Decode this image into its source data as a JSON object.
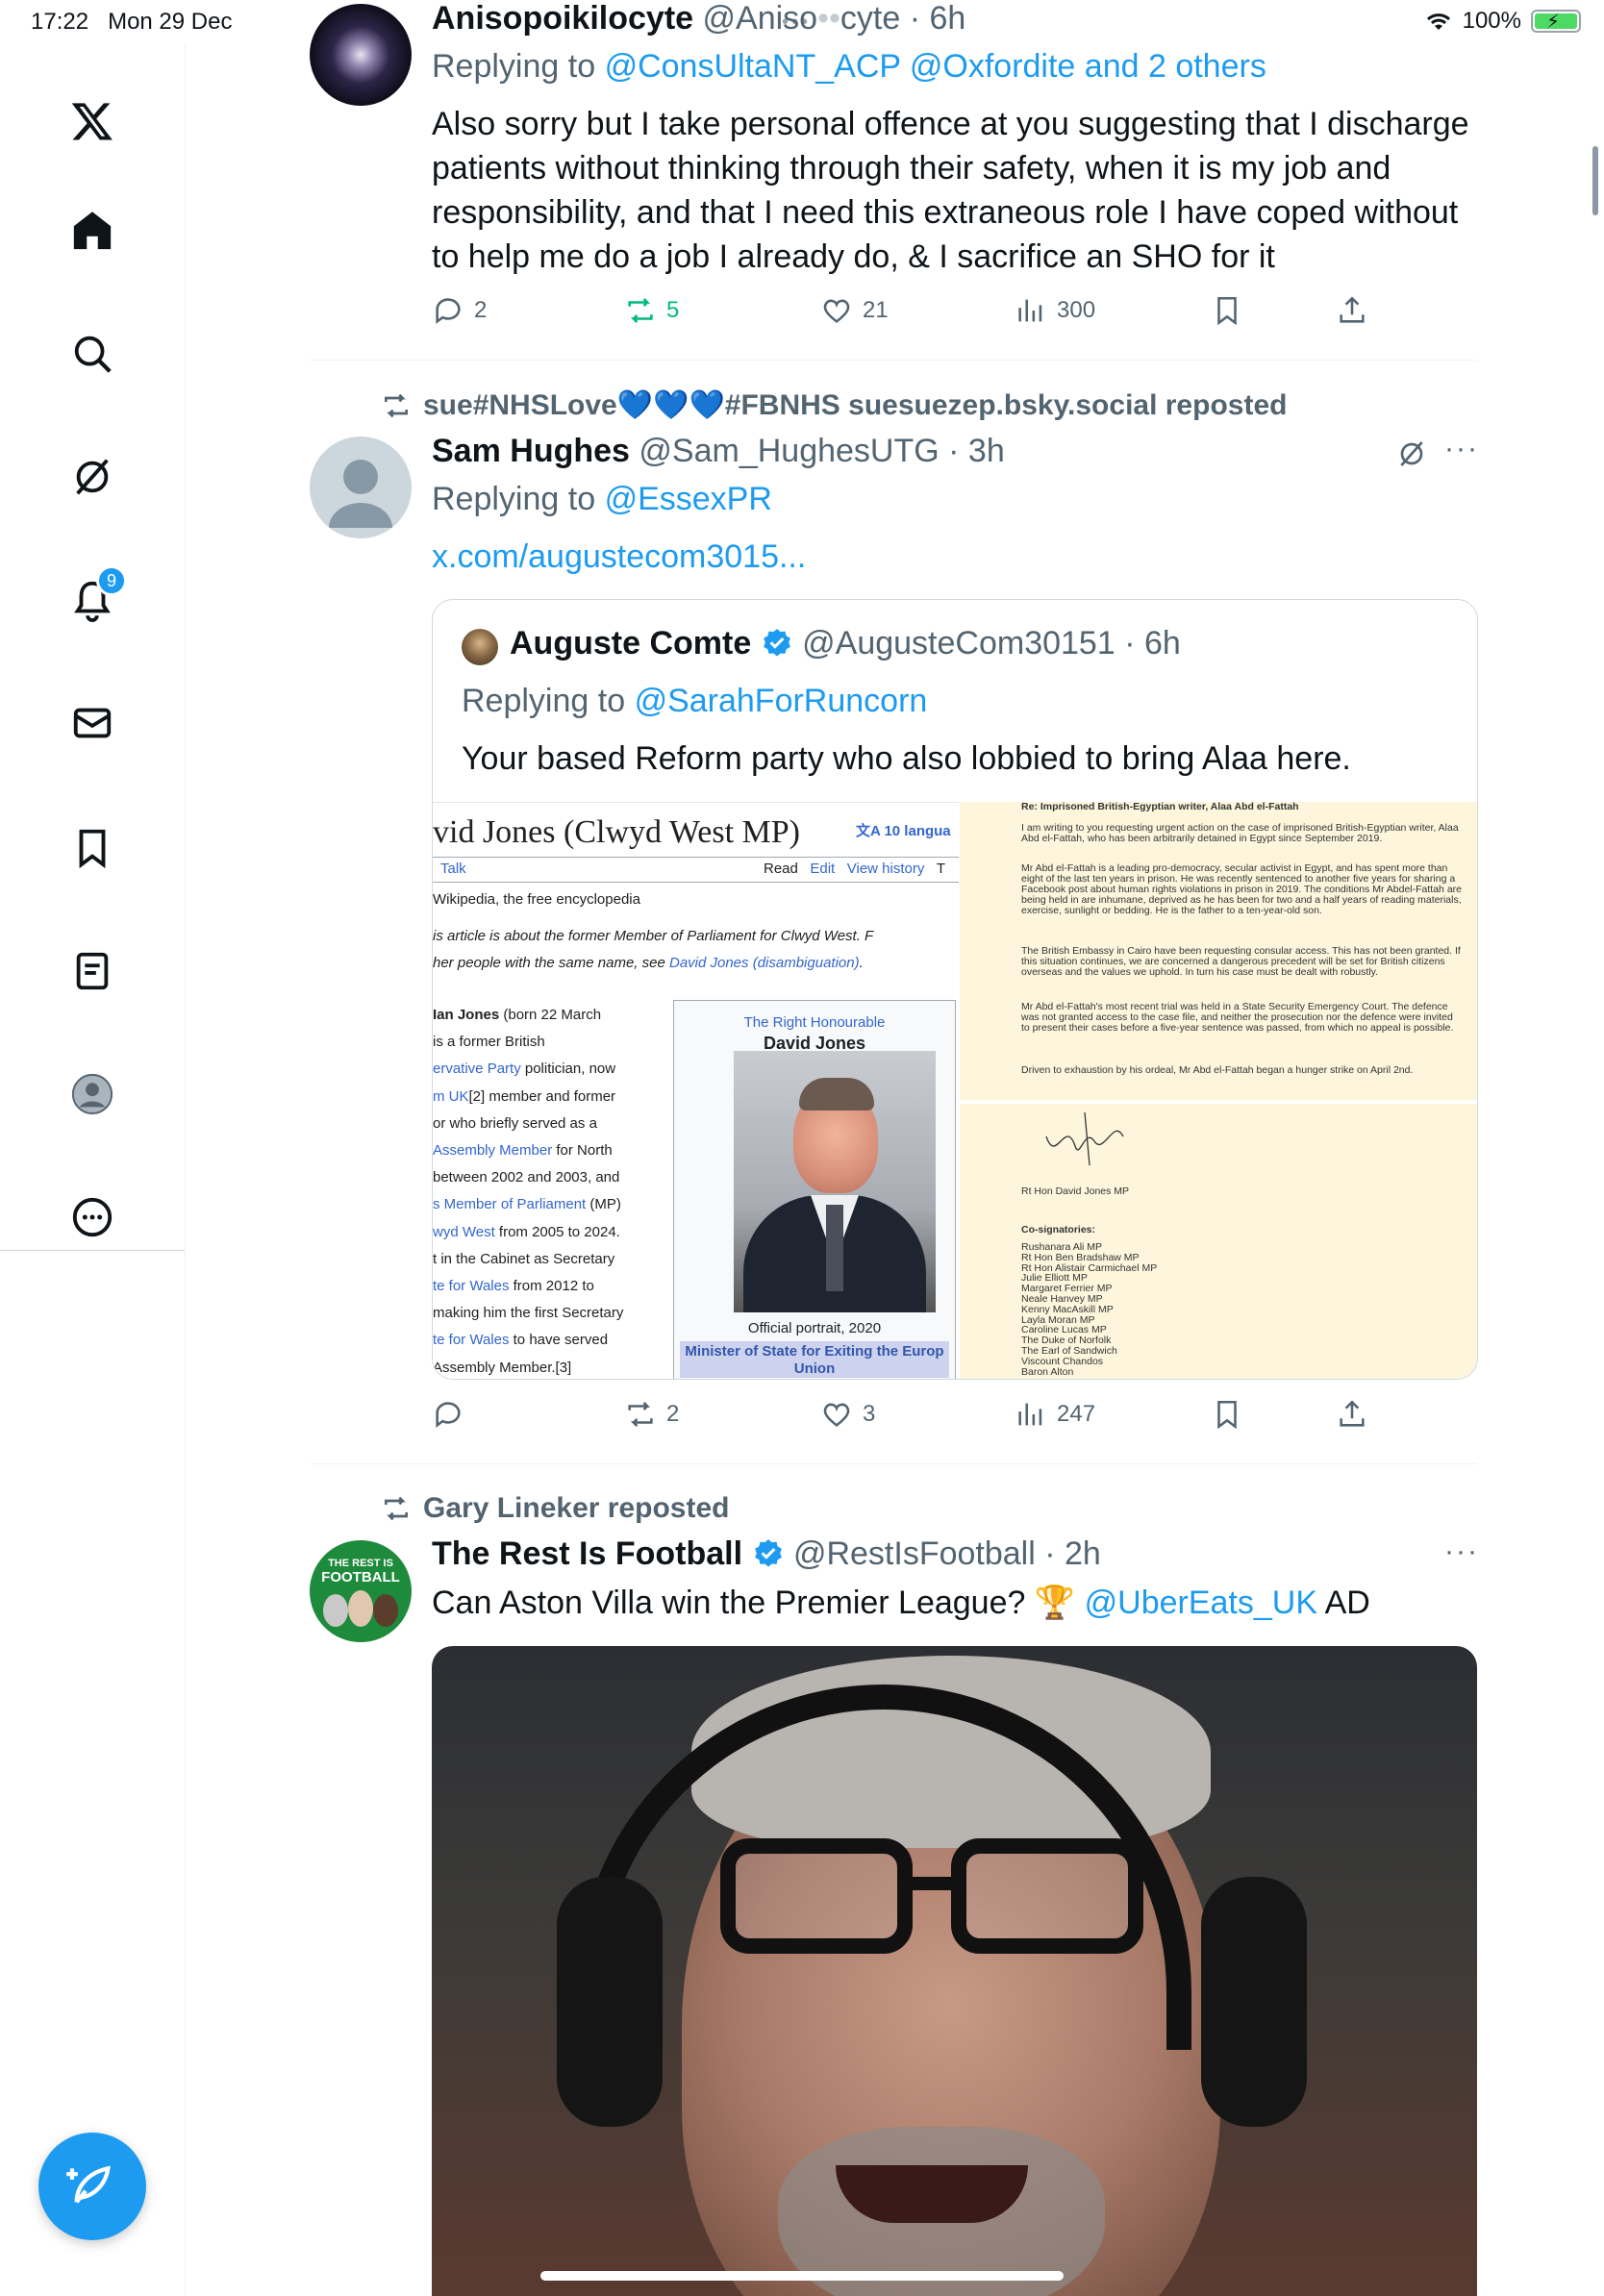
{
  "status_bar": {
    "time": "17:22",
    "date": "Mon 29 Dec",
    "battery": "100%"
  },
  "sidebar": {
    "items": [
      {
        "icon": "x-logo-icon"
      },
      {
        "icon": "home-icon"
      },
      {
        "icon": "search-icon"
      },
      {
        "icon": "grok-icon"
      },
      {
        "icon": "bell-icon",
        "badge": "9"
      },
      {
        "icon": "mail-icon"
      },
      {
        "icon": "bookmark-icon"
      },
      {
        "icon": "lists-icon"
      },
      {
        "icon": "profile-icon"
      },
      {
        "icon": "more-icon"
      }
    ],
    "compose_icon": "compose-icon"
  },
  "tweets": [
    {
      "name": "Anisopoikilocyte",
      "handle": "@Aniso",
      "handle_tail": "cyte",
      "time": "· 6h",
      "replying_prefix": "Replying to",
      "replying_to": "@ConsUltaNT_ACP @Oxfordite and 2 others",
      "text_lines": [
        "Also sorry but I take personal offence at you suggesting that I discharge",
        "patients without thinking through their safety, when it is my job and",
        "responsibility, and that I need this extraneous role I have coped without",
        "to help me do a job I already do, & I sacrifice an SHO for it"
      ],
      "actions": {
        "replies": "2",
        "reposts": "5",
        "likes": "21",
        "views": "300"
      }
    },
    {
      "repost_line": "sue#NHSLove💙💙💙#FBNHS suesuezep.bsky.social reposted",
      "name": "Sam Hughes",
      "handle": "@Sam_HughesUTG",
      "time": "· 3h",
      "replying_prefix": "Replying to",
      "replying_to": "@EssexPR",
      "link": "x.com/augustecom3015...",
      "quote": {
        "name": "Auguste Comte",
        "handle": "@AugusteCom30151",
        "time": "· 6h",
        "replying_prefix": "Replying to",
        "replying_to": "@SarahForRuncorn",
        "text": "Your based Reform party who also lobbied to bring Alaa here.",
        "wiki": {
          "title": "vid Jones (Clwyd West MP)",
          "languages": "10 langua",
          "tab_talk": "Talk",
          "tab_read": "Read",
          "tab_edit": "Edit",
          "tab_history": "View history",
          "tab_t": "T",
          "from": "Wikipedia, the free encyclopedia",
          "hatnote1": "is article is about the former Member of Parliament for Clwyd West. F",
          "hatnote2_prefix": "her people with the same name, see ",
          "hatnote2_link": "David Jones (disambiguation)",
          "hatnote2_suffix": ".",
          "body_lines": [
            [
              "Ian Jones",
              " (born 22 March"
            ],
            [
              "",
              " is a former British"
            ],
            [
              "ervative Party",
              " politician, now"
            ],
            [
              "m UK",
              "[2] member and former"
            ],
            [
              "",
              "or who briefly served as a"
            ],
            [
              "Assembly Member",
              " for North"
            ],
            [
              "",
              " between 2002 and 2003, and"
            ],
            [
              "s Member of Parliament",
              " (MP)"
            ],
            [
              "wyd West",
              " from 2005 to 2024."
            ],
            [
              "",
              "t in the Cabinet as Secretary"
            ],
            [
              "te for Wales",
              " from 2012 to"
            ],
            [
              "",
              "making him the first Secretary"
            ],
            [
              "te for Wales",
              " to have served"
            ],
            [
              "",
              " Assembly Member.[3]"
            ]
          ],
          "infobox_title1": "The Right Honourable",
          "infobox_title2": "David Jones",
          "caption": "Official portrait, 2020",
          "office1": "Minister of State for Exiting the Europ",
          "office2": "Union"
        },
        "letter": {
          "heading": "Re: Imprisoned British-Egyptian writer, Alaa Abd el-Fattah",
          "paragraphs": [
            "I am writing to you requesting urgent action on the case of imprisoned British-Egyptian writer, Alaa Abd el-Fattah, who has been arbitrarily detained in Egypt since September 2019.",
            "Mr Abd el-Fattah is a leading pro-democracy, secular activist in Egypt, and has spent more than eight of the last ten years in prison. He was recently sentenced to another five years for sharing a Facebook post about human rights violations in prison in 2019. The conditions Mr Abdel-Fattah are being held in are inhumane, deprived as he has been for two and a half years of reading materials, exercise, sunlight or bedding. He is the father to a ten-year-old son.",
            "The British Embassy in Cairo have been requesting consular access. This has not been granted. If this situation continues, we are concerned a dangerous precedent will be set for British citizens overseas and the values we uphold. In turn his case must be dealt with robustly.",
            "Mr Abd el-Fattah's most recent trial was held in a State Security Emergency Court. The defence was not granted access to the case file, and neither the prosecution nor the defence were invited to present their cases before a five-year sentence was passed, from which no appeal is possible.",
            "Driven to exhaustion by his ordeal, Mr Abd el-Fattah began a hunger strike on April 2nd."
          ],
          "signer": "Rt Hon David Jones MP",
          "cosign_label": "Co-signatories:",
          "cosigners": [
            "Rushanara Ali MP",
            "Rt Hon Ben Bradshaw MP",
            "Rt Hon Alistair Carmichael MP",
            "Julie Elliott MP",
            "Margaret Ferrier MP",
            "Neale Hanvey MP",
            "Kenny MacAskill MP",
            "Layla Moran MP",
            "Caroline Lucas MP",
            "The Duke of Norfolk",
            "The Earl of Sandwich",
            "Viscount Chandos",
            "Baron Alton"
          ]
        }
      },
      "actions": {
        "replies": "",
        "reposts": "2",
        "likes": "3",
        "views": "247"
      }
    },
    {
      "repost_line": "Gary Lineker reposted",
      "name": "The Rest Is Football",
      "handle": "@RestIsFootball",
      "time": "· 2h",
      "text_prefix": "Can Aston Villa win the Premier League? 🏆 ",
      "text_mention": "@UberEats_UK",
      "text_suffix": " AD",
      "avatar_text1": "THE REST IS",
      "avatar_text2": "FOOTBALL"
    }
  ],
  "colors": {
    "accent": "#1d9bf0",
    "muted": "#536471",
    "repost_green": "#00ba7c"
  }
}
